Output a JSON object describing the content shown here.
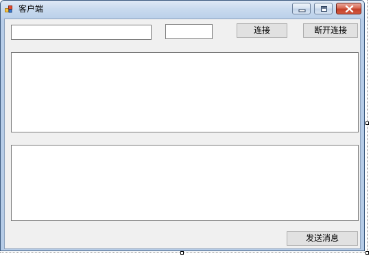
{
  "window": {
    "title": "客户端",
    "controls": {
      "minimize_icon": "minimize-icon",
      "maximize_icon": "maximize-icon",
      "close_icon": "close-icon"
    }
  },
  "form": {
    "ip_input": {
      "value": "",
      "placeholder": ""
    },
    "port_input": {
      "value": "",
      "placeholder": ""
    },
    "connect_label": "连接",
    "disconnect_label": "断开连接",
    "log_textarea": {
      "value": ""
    },
    "message_textarea": {
      "value": ""
    },
    "send_label": "发送消息"
  },
  "colors": {
    "form_background": "#f0f0f0",
    "button_face": "#e1e1e1",
    "titlebar": "#c9daee",
    "close_button": "#c4412a"
  }
}
